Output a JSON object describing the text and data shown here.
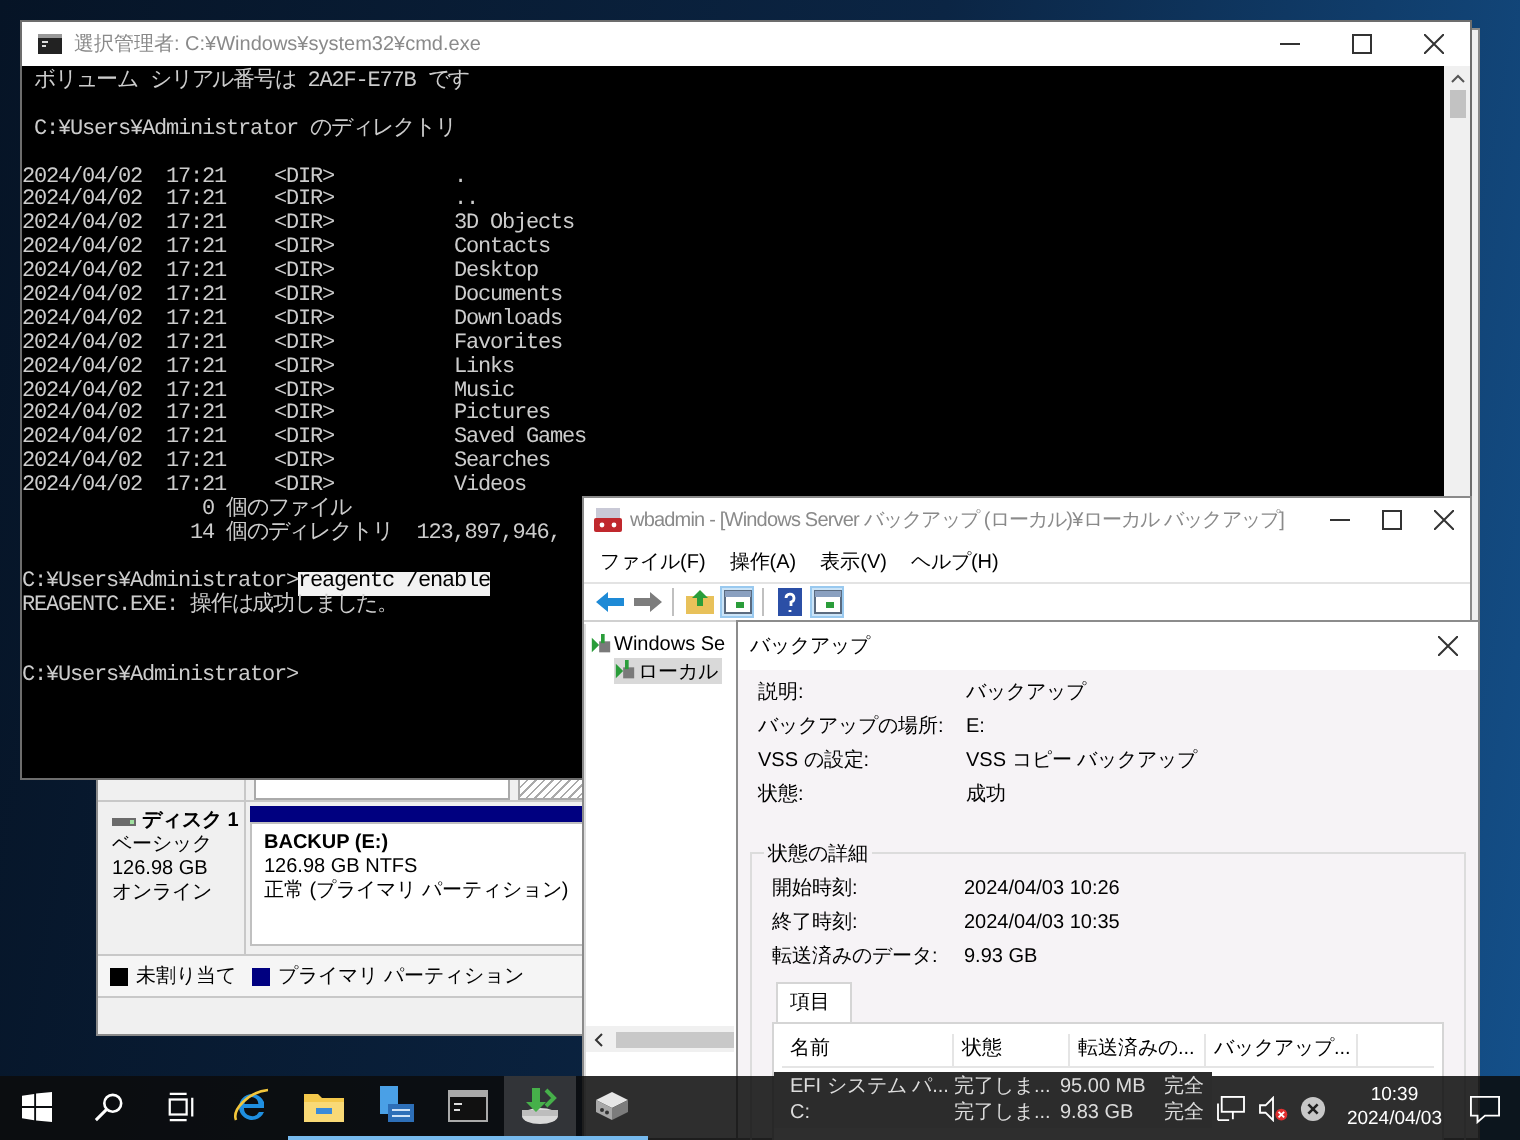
{
  "disk_management": {
    "disk": {
      "name": "ディスク 1",
      "type": "ベーシック",
      "size": "126.98 GB",
      "status": "オンライン"
    },
    "partition": {
      "name": "BACKUP  (E:)",
      "size": "126.98 GB NTFS",
      "status": "正常 (プライマリ パーティション)",
      "color": "#000080"
    },
    "legend": [
      {
        "label": "未割り当て",
        "color": "#000000"
      },
      {
        "label": "プライマリ パーティション",
        "color": "#000080"
      }
    ]
  },
  "cmd": {
    "title": "選択管理者: C:¥Windows¥system32¥cmd.exe",
    "lines": [
      {
        "kind": "text",
        "text": " ボリューム シリアル番号は 2A2F-E77B です"
      },
      {
        "kind": "blank"
      },
      {
        "kind": "text",
        "text": " C:¥Users¥Administrator のディレクトリ"
      },
      {
        "kind": "blank"
      },
      {
        "kind": "text",
        "text": "2024/04/02  17:21    <DIR>          ."
      },
      {
        "kind": "text",
        "text": "2024/04/02  17:21    <DIR>          .."
      },
      {
        "kind": "text",
        "text": "2024/04/02  17:21    <DIR>          3D Objects"
      },
      {
        "kind": "text",
        "text": "2024/04/02  17:21    <DIR>          Contacts"
      },
      {
        "kind": "text",
        "text": "2024/04/02  17:21    <DIR>          Desktop"
      },
      {
        "kind": "text",
        "text": "2024/04/02  17:21    <DIR>          Documents"
      },
      {
        "kind": "text",
        "text": "2024/04/02  17:21    <DIR>          Downloads"
      },
      {
        "kind": "text",
        "text": "2024/04/02  17:21    <DIR>          Favorites"
      },
      {
        "kind": "text",
        "text": "2024/04/02  17:21    <DIR>          Links"
      },
      {
        "kind": "text",
        "text": "2024/04/02  17:21    <DIR>          Music"
      },
      {
        "kind": "text",
        "text": "2024/04/02  17:21    <DIR>          Pictures"
      },
      {
        "kind": "text",
        "text": "2024/04/02  17:21    <DIR>          Saved Games"
      },
      {
        "kind": "text",
        "text": "2024/04/02  17:21    <DIR>          Searches"
      },
      {
        "kind": "text",
        "text": "2024/04/02  17:21    <DIR>          Videos"
      },
      {
        "kind": "text",
        "text": "               0 個のファイル"
      },
      {
        "kind": "text",
        "text": "              14 個のディレクトリ  123,897,946,"
      },
      {
        "kind": "blank"
      },
      {
        "kind": "command",
        "prompt": "C:¥Users¥Administrator>",
        "command": "reagentc /enable",
        "selected": true
      },
      {
        "kind": "text",
        "text": "REAGENTC.EXE: 操作は成功しました。"
      },
      {
        "kind": "blank"
      },
      {
        "kind": "blank"
      },
      {
        "kind": "text",
        "text": "C:¥Users¥Administrator>"
      }
    ]
  },
  "wbadmin": {
    "title": "wbadmin - [Windows Server バックアップ (ローカル)¥ローカル バックアップ]",
    "menu": [
      "ファイル(F)",
      "操作(A)",
      "表示(V)",
      "ヘルプ(H)"
    ],
    "toolbar": [
      {
        "kind": "back",
        "selected": false
      },
      {
        "kind": "forward",
        "selected": false
      },
      {
        "kind": "up",
        "selected": false
      },
      {
        "kind": "panel",
        "selected": true
      },
      {
        "kind": "help",
        "selected": false
      },
      {
        "kind": "panel",
        "selected": true
      }
    ],
    "tree": [
      {
        "label": "Windows Se",
        "selected": false
      },
      {
        "label": "ローカル",
        "selected": true
      }
    ]
  },
  "dialog": {
    "title": "バックアップ",
    "fields": [
      {
        "label": "説明:",
        "value": "バックアップ"
      },
      {
        "label": "バックアップの場所:",
        "value": "E:"
      },
      {
        "label": "VSS の設定:",
        "value": "VSS コピー バックアップ"
      },
      {
        "label": "状態:",
        "value": "成功"
      }
    ],
    "details_title": "状態の詳細",
    "details": [
      {
        "label": "開始時刻:",
        "value": "2024/04/03 10:26"
      },
      {
        "label": "終了時刻:",
        "value": "2024/04/03 10:35"
      },
      {
        "label": "転送済みのデータ:",
        "value": "9.93 GB"
      }
    ],
    "tabs": [
      {
        "label": "項目",
        "selected": true
      }
    ],
    "table": {
      "columns": [
        "名前",
        "状態",
        "転送済みの...",
        "バックアップ..."
      ],
      "rows": [
        [
          "EFI システム パ...",
          "完了しま...",
          "95.00 MB",
          "完全"
        ],
        [
          "C:",
          "完了しま...",
          "9.83 GB",
          "完全"
        ]
      ]
    }
  },
  "taskbar": {
    "items": [
      {
        "kind": "start",
        "running": false,
        "selected": false
      },
      {
        "kind": "search",
        "running": false,
        "selected": false
      },
      {
        "kind": "taskview",
        "running": false,
        "selected": false
      },
      {
        "kind": "browser",
        "running": false,
        "selected": false
      },
      {
        "kind": "folder",
        "running": true,
        "selected": false
      },
      {
        "kind": "server",
        "running": true,
        "selected": false
      },
      {
        "kind": "console",
        "running": true,
        "selected": false
      },
      {
        "kind": "backup",
        "running": true,
        "selected": true
      },
      {
        "kind": "drive",
        "running": true,
        "selected": false
      }
    ],
    "time": "10:39",
    "date": "2024/04/03"
  }
}
